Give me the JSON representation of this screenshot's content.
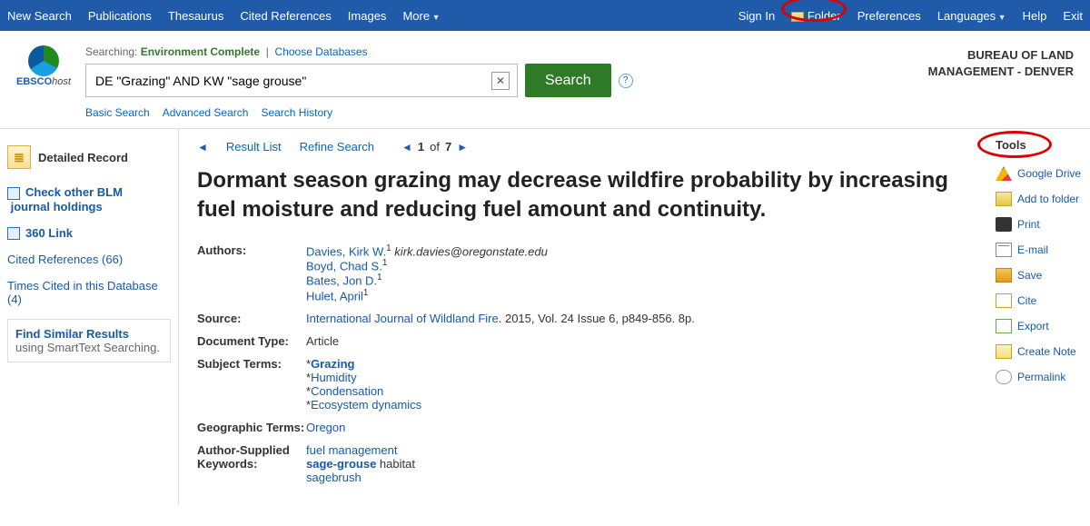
{
  "topbar": {
    "left": [
      "New Search",
      "Publications",
      "Thesaurus",
      "Cited References",
      "Images",
      "More"
    ],
    "right": [
      "Sign In",
      "Folder",
      "Preferences",
      "Languages",
      "Help",
      "Exit"
    ]
  },
  "header": {
    "logo_text_a": "EBSCO",
    "logo_text_b": "host",
    "searching": "Searching:",
    "dbname": "Environment Complete",
    "choose": "Choose Databases",
    "query": "DE \"Grazing\" AND KW \"sage grouse\"",
    "search_btn": "Search",
    "links": [
      "Basic Search",
      "Advanced Search",
      "Search History"
    ],
    "org1": "BUREAU OF LAND",
    "org2": "MANAGEMENT - DENVER"
  },
  "left": {
    "detailed": "Detailed Record",
    "checkblm1": "Check other BLM",
    "checkblm2": "journal holdings",
    "link360": "360 Link",
    "cited": "Cited References (66)",
    "times": "Times Cited in this Database (4)",
    "findsim": "Find Similar Results",
    "smart": "using SmartText Searching."
  },
  "nav": {
    "resultlist": "Result List",
    "refine": "Refine Search",
    "pager_pre": "1",
    "pager_mid": " of ",
    "pager_post": "7"
  },
  "article": {
    "title": "Dormant season grazing may decrease wildfire probability by increasing fuel moisture and reducing fuel amount and continuity.",
    "labels": {
      "authors": "Authors:",
      "source": "Source:",
      "doctype": "Document Type:",
      "subj": "Subject Terms:",
      "geo": "Geographic Terms:",
      "askw": "Author-Supplied Keywords:"
    },
    "authors": {
      "a1": "Davies, Kirk W.",
      "a1e": " kirk.davies@oregonstate.edu",
      "a2": "Boyd, Chad S.",
      "a3": "Bates, Jon D.",
      "a4": "Hulet, April"
    },
    "source_link": "International Journal of Wildland Fire",
    "source_rest": ". 2015, Vol. 24 Issue 6, p849-856. 8p.",
    "doctype": "Article",
    "subj": {
      "s1": "Grazing",
      "s2": "Humidity",
      "s3": "Condensation",
      "s4": "Ecosystem dynamics"
    },
    "geo": "Oregon",
    "askw": {
      "k1": "fuel management",
      "k2": "sage-grouse",
      "k2b": " habitat",
      "k3": "sagebrush"
    }
  },
  "tools": {
    "heading": "Tools",
    "items": {
      "gd": "Google Drive",
      "fold": "Add to folder",
      "print": "Print",
      "mail": "E-mail",
      "save": "Save",
      "cite": "Cite",
      "export": "Export",
      "note": "Create Note",
      "perm": "Permalink"
    }
  }
}
